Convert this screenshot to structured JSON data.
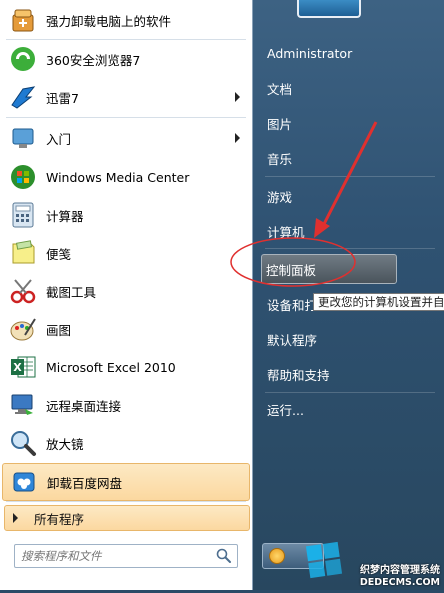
{
  "programs": [
    {
      "label": "强力卸载电脑上的软件",
      "icon": "uninstall-box-icon",
      "arrow": false
    },
    {
      "label": "360安全浏览器7",
      "icon": "360-browser-icon",
      "arrow": false
    },
    {
      "label": "迅雷7",
      "icon": "thunder-bird-icon",
      "arrow": true
    },
    {
      "label": "入门",
      "icon": "getting-started-icon",
      "arrow": true
    },
    {
      "label": "Windows Media Center",
      "icon": "windows-media-center-icon",
      "arrow": false
    },
    {
      "label": "计算器",
      "icon": "calculator-icon",
      "arrow": false
    },
    {
      "label": "便笺",
      "icon": "sticky-notes-icon",
      "arrow": false
    },
    {
      "label": "截图工具",
      "icon": "snipping-tool-icon",
      "arrow": false
    },
    {
      "label": "画图",
      "icon": "paint-icon",
      "arrow": false
    },
    {
      "label": "Microsoft Excel 2010",
      "icon": "excel-icon",
      "arrow": false
    },
    {
      "label": "远程桌面连接",
      "icon": "remote-desktop-icon",
      "arrow": false
    },
    {
      "label": "放大镜",
      "icon": "magnifier-icon",
      "arrow": false
    },
    {
      "label": "卸载百度网盘",
      "icon": "baidu-netdisk-icon",
      "arrow": false
    }
  ],
  "all_programs_label": "所有程序",
  "search": {
    "placeholder": "搜索程序和文件"
  },
  "right_items": [
    {
      "label": "Administrator"
    },
    {
      "label": "文档"
    },
    {
      "label": "图片"
    },
    {
      "label": "音乐"
    },
    {
      "label": "游戏"
    },
    {
      "label": "计算机"
    },
    {
      "label": "控制面板"
    },
    {
      "label": "设备和打"
    },
    {
      "label": "默认程序"
    },
    {
      "label": "帮助和支持"
    },
    {
      "label": "运行..."
    }
  ],
  "tooltip": "更改您的计算机设置并自",
  "watermark": {
    "line1": "织梦内容管理系统",
    "line2": "DEDECMS.COM"
  },
  "colors": {
    "annotation": "#e0302f",
    "highlight": "#fbd8a0"
  }
}
